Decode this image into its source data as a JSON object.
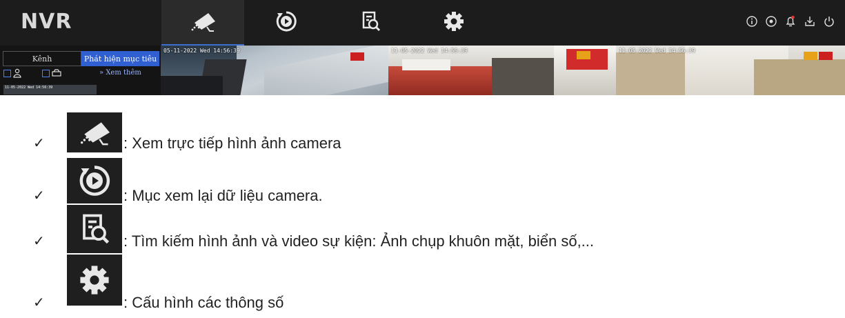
{
  "app": {
    "logo": "NVR"
  },
  "topbar": {
    "tabs": [
      {
        "icon": "camera-icon",
        "active": true
      },
      {
        "icon": "playback-icon",
        "active": false
      },
      {
        "icon": "search-file-icon",
        "active": false
      },
      {
        "icon": "gear-icon",
        "active": false
      }
    ],
    "right_icons": [
      "info-icon",
      "record-icon",
      "notification-bell-icon",
      "download-icon",
      "power-icon"
    ]
  },
  "panel": {
    "segments": [
      "Kênh",
      "Phát hiện mục tiêu"
    ],
    "see_more": "Xem thêm",
    "thumb_timestamp": "11-05-2022 Wed 14:56:39"
  },
  "feeds": [
    {
      "timestamp": "05-11-2022 Wed 14:56:39"
    },
    {
      "timestamp": "11-05-2022 Wed 14:56:39"
    },
    {
      "timestamp": "11-05-2022 Wed 14:56:39"
    }
  ],
  "legend": [
    {
      "icon": "camera-icon",
      "text": ": Xem trực tiếp hình ảnh camera"
    },
    {
      "icon": "playback-icon",
      "text": ": Mục xem lại dữ liệu camera."
    },
    {
      "icon": "search-file-icon",
      "text": ": Tìm kiếm hình ảnh và video sự kiện: Ảnh chụp khuôn mặt, biển số,..."
    },
    {
      "icon": "gear-icon",
      "text": ": Cấu hình các thông số"
    }
  ],
  "colors": {
    "accent": "#2f5fd0",
    "bar": "#1c1c1c",
    "alert_dot": "#e53935"
  }
}
